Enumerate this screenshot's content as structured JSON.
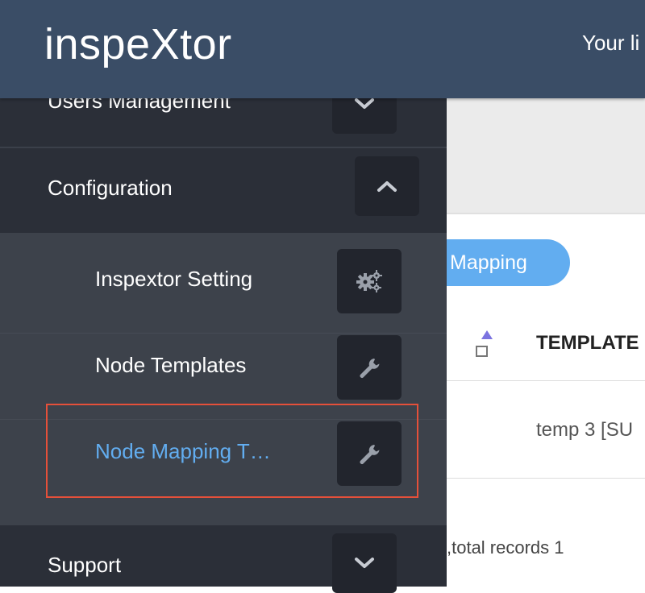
{
  "header": {
    "brand": "inspeXtor",
    "welcome_text": "Your li"
  },
  "sidebar": {
    "users_management": {
      "label": "Users Management",
      "icon": "chevron-down-icon"
    },
    "configuration": {
      "label": "Configuration",
      "icon": "chevron-up-icon"
    },
    "submenu": [
      {
        "label": "Inspextor Setting",
        "icon": "gears-icon"
      },
      {
        "label": "Node Templates",
        "icon": "wrench-icon"
      },
      {
        "label": "Node Mapping T…",
        "icon": "wrench-icon",
        "active": true
      }
    ],
    "support": {
      "label": "Support",
      "icon": "chevron-down-icon"
    }
  },
  "main": {
    "mapping_button": "Mapping",
    "column_header": "TEMPLATE",
    "cell_value": "temp 3 [SU",
    "records_text": ",total records 1"
  },
  "colors": {
    "header_bg": "#3a4d66",
    "sidebar_bg": "#2a2e37",
    "submenu_bg": "#3d424b",
    "active_link": "#62adf0",
    "highlight_border": "#e5503a",
    "button_bg": "#62adf0"
  }
}
